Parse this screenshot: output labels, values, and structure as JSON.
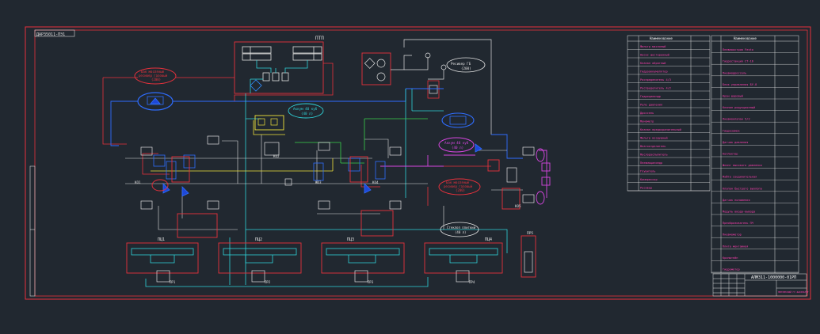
{
  "title_block": {
    "corner_stamp": "ДАРЗ5011-ПЭ1",
    "designation": "АЛМЗ11-1000000-01РП",
    "org_stamp": "ПЕНЗЕНСКИЙ ГУ ФАКУЛЬТЕТ"
  },
  "labels": {
    "upper_unit": "ПТП",
    "cylinder_group_1": "ПЦ1",
    "cylinder_group_2": "ПЦ2",
    "cylinder_group_3": "ПЦ3",
    "cylinder_group_4": "ПЦ4",
    "pressure_switch_1": "ПР1",
    "pressure_switch_2": "ПР2",
    "pressure_switch_3": "ПР3",
    "pressure_switch_4": "ПР4",
    "cabinet": "ПР5",
    "valve_1": "КО1",
    "valve_2": "КО2",
    "valve_3": "КО3",
    "valve_4": "КО4",
    "valve_5": "КО5",
    "accumulator_left": "Аккум 40 куб",
    "accumulator_left_sub": "(40 л)",
    "accumulator_right": "Аккум 40 куб",
    "accumulator_right_sub": "(40 л)",
    "accumulator_bottom": "Стеклоп плиткий",
    "accumulator_bottom_sub": "(40 л)",
    "receiver_top": "Ресивер ГБ",
    "receiver_top_sub": "(200)",
    "tank_left_1": "Бак масляный",
    "tank_left_2": "ресивер газовый",
    "tank_left_3": "(200)",
    "tank_right_1": "Бак масляный",
    "tank_right_2": "ресивер газовый",
    "tank_right_3": "(200)"
  },
  "spec_table": {
    "left_header": "Наименование",
    "right_header": "Наименование",
    "left_rows": [
      "Фильтр масляный",
      "Насос шестеренный",
      "Клапан обратный",
      "Гидроаккумулятор",
      "Распределитель 4/3",
      "Распределитель 4/2",
      "Гидроцилиндр",
      "Реле давления",
      "Дроссель",
      "Манометр",
      "Клапан предохранительный",
      "Фильтр воздушный",
      "Влагоотделитель",
      "Маслораспылитель",
      "Пневмоцилиндр",
      "Глушитель",
      "Компрессор",
      "Ресивер"
    ],
    "right_rows": [
      "Пневмоостров Festo",
      "Гидростанция СТ-16",
      "Пневмодроссель",
      "Блок управления БУ-8",
      "Кран шаровый",
      "Клапан редукционный",
      "Пневмоклапан 5/2",
      "Гидрозамок",
      "Датчик давления",
      "Коллектор",
      "Шланг высокого давления",
      "Муфта соединительная",
      "Клапан быстрого выхлопа",
      "Датчик положения",
      "Модуль ввода-вывода",
      "Преобразователь ПЧ",
      "Пневмомотор",
      "Плита монтажная",
      "Кронштейн",
      "Гидромотор"
    ]
  }
}
